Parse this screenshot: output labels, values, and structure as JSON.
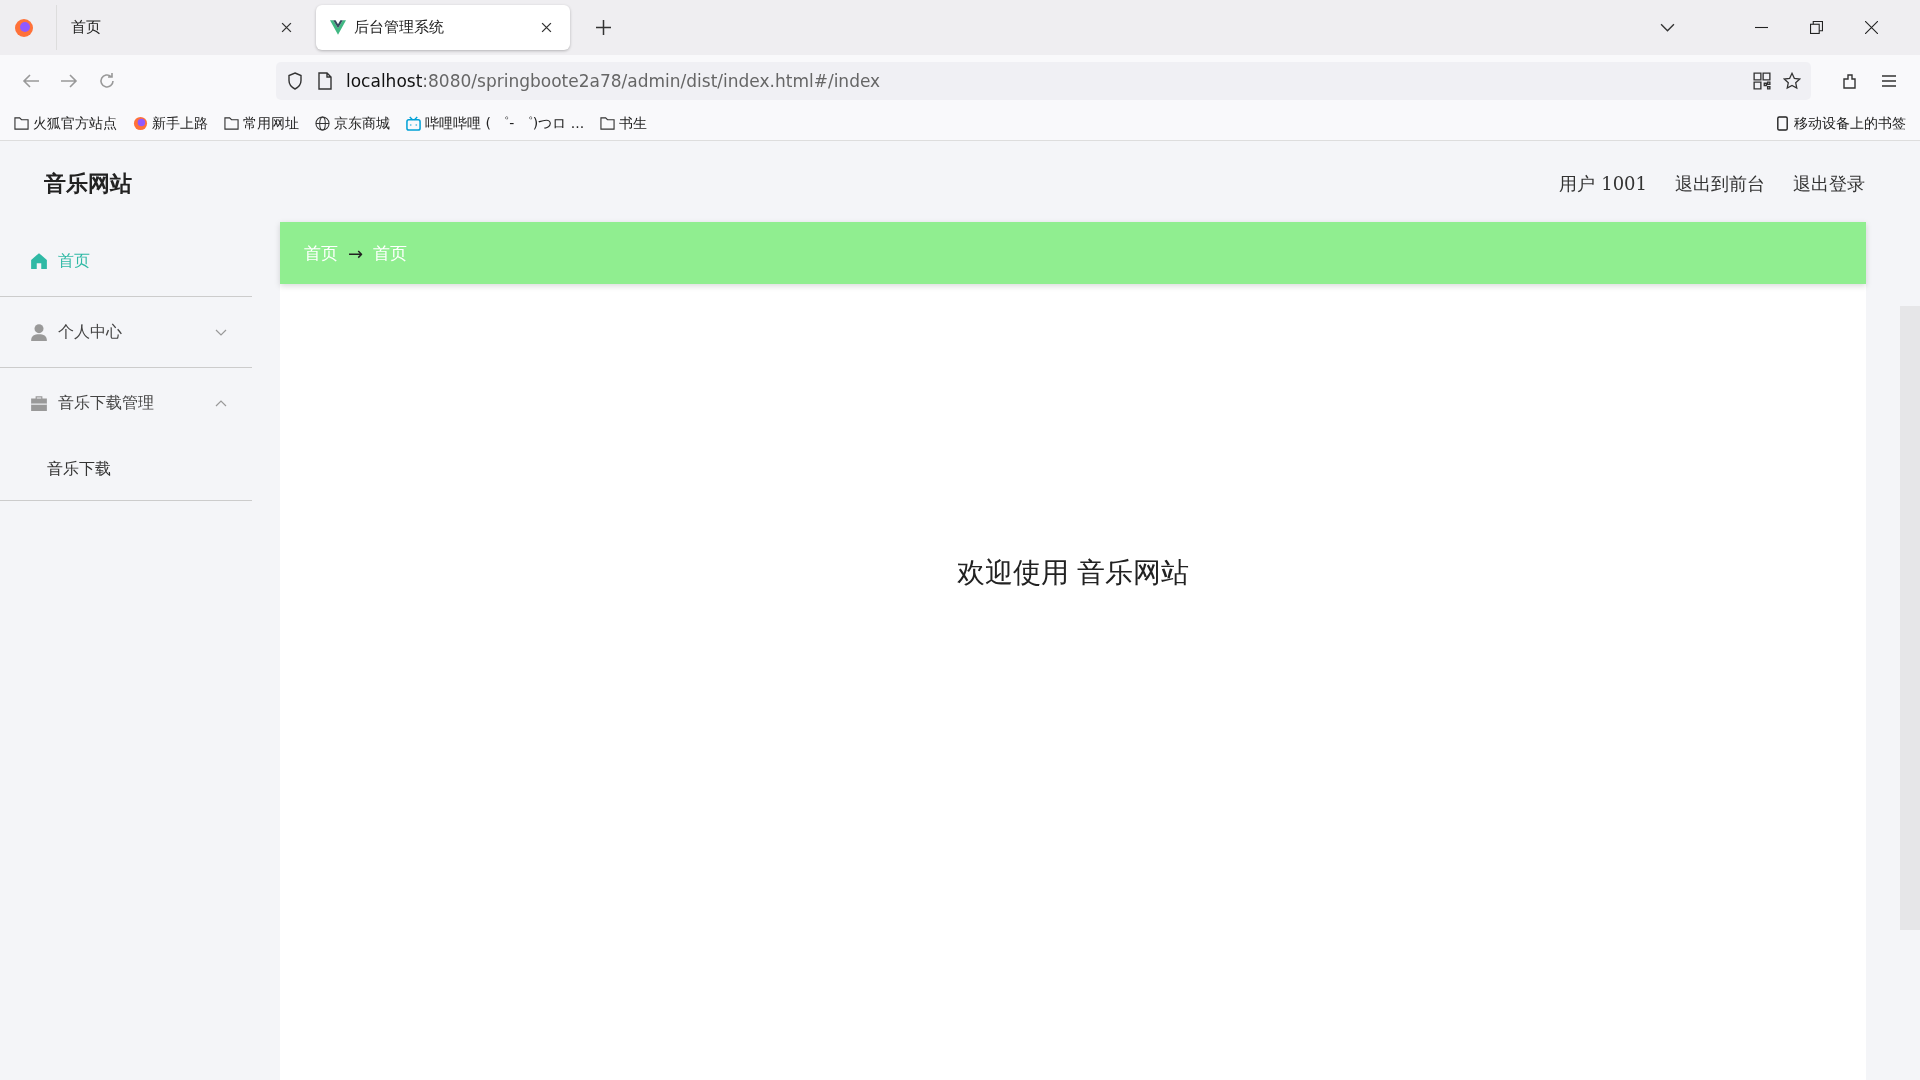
{
  "browser": {
    "tabs": [
      {
        "title": "首页",
        "kind": "firefox",
        "selected": false
      },
      {
        "title": "后台管理系统",
        "kind": "vue",
        "selected": true
      }
    ],
    "url": {
      "host": "localhost",
      "path": ":8080/springboote2a78/admin/dist/index.html#/index"
    },
    "bookmarks": [
      {
        "label": "火狐官方站点",
        "kind": "folder"
      },
      {
        "label": "新手上路",
        "kind": "firefox"
      },
      {
        "label": "常用网址",
        "kind": "folder"
      },
      {
        "label": "京东商城",
        "kind": "globe"
      },
      {
        "label": "哔哩哔哩 ( ゜- ゜)つロ ...",
        "kind": "tv"
      },
      {
        "label": "书生",
        "kind": "folder"
      }
    ],
    "mobile_bookmarks": "移动设备上的书签"
  },
  "app": {
    "title": "音乐网站",
    "header_links": [
      "用户 1001",
      "退出到前台",
      "退出登录"
    ],
    "menu": [
      {
        "label": "首页",
        "kind": "home",
        "selected": true
      },
      {
        "label": "个人中心",
        "kind": "user",
        "selected": false,
        "expanded": false
      },
      {
        "label": "音乐下载管理",
        "kind": "briefcase",
        "selected": false,
        "expanded": true,
        "children": [
          {
            "label": "音乐下载",
            "selected": false
          }
        ]
      }
    ],
    "breadcrumb": {
      "items": [
        "首页",
        "首页"
      ],
      "separator": "→"
    },
    "welcome": "欢迎使用 音乐网站"
  }
}
